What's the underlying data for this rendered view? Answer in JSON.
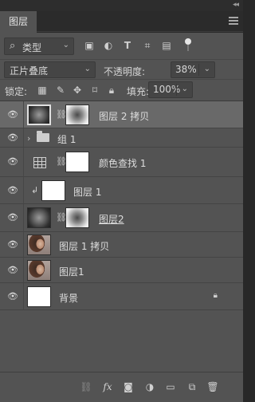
{
  "panel": {
    "tab_label": "图层",
    "close_glyph": "✕",
    "collapse_glyph": "◂◂"
  },
  "filter": {
    "kind_label": "类型",
    "icons": [
      "image-filter-icon",
      "adjustment-filter-icon",
      "type-filter-icon",
      "shape-filter-icon",
      "smart-object-filter-icon"
    ]
  },
  "blend": {
    "mode": "正片叠底",
    "opacity_label": "不透明度:",
    "opacity_value": "38%"
  },
  "locks": {
    "label": "锁定:",
    "fill_label": "填充:",
    "fill_value": "100%"
  },
  "layers": [
    {
      "name": "图层 2 拷贝",
      "type": "masked-pixel",
      "selected": true,
      "visible": true
    },
    {
      "name": "组 1",
      "type": "group",
      "selected": false,
      "visible": true
    },
    {
      "name": "颜色查找 1",
      "type": "adjustment",
      "selected": false,
      "visible": true
    },
    {
      "name": "图层 1",
      "type": "clipped",
      "selected": false,
      "visible": true
    },
    {
      "name": "图层2",
      "type": "masked-pixel",
      "selected": false,
      "visible": true
    },
    {
      "name": "图层 1 拷贝",
      "type": "photo",
      "selected": false,
      "visible": true
    },
    {
      "name": "图层1",
      "type": "photo",
      "selected": false,
      "visible": true
    },
    {
      "name": "背景",
      "type": "background",
      "selected": false,
      "visible": true,
      "locked": true
    }
  ],
  "bottom_icons": [
    "link-layers-icon",
    "fx-icon",
    "add-mask-icon",
    "new-adjustment-icon",
    "new-group-icon",
    "new-layer-icon",
    "delete-layer-icon"
  ],
  "fx_label": "fx"
}
